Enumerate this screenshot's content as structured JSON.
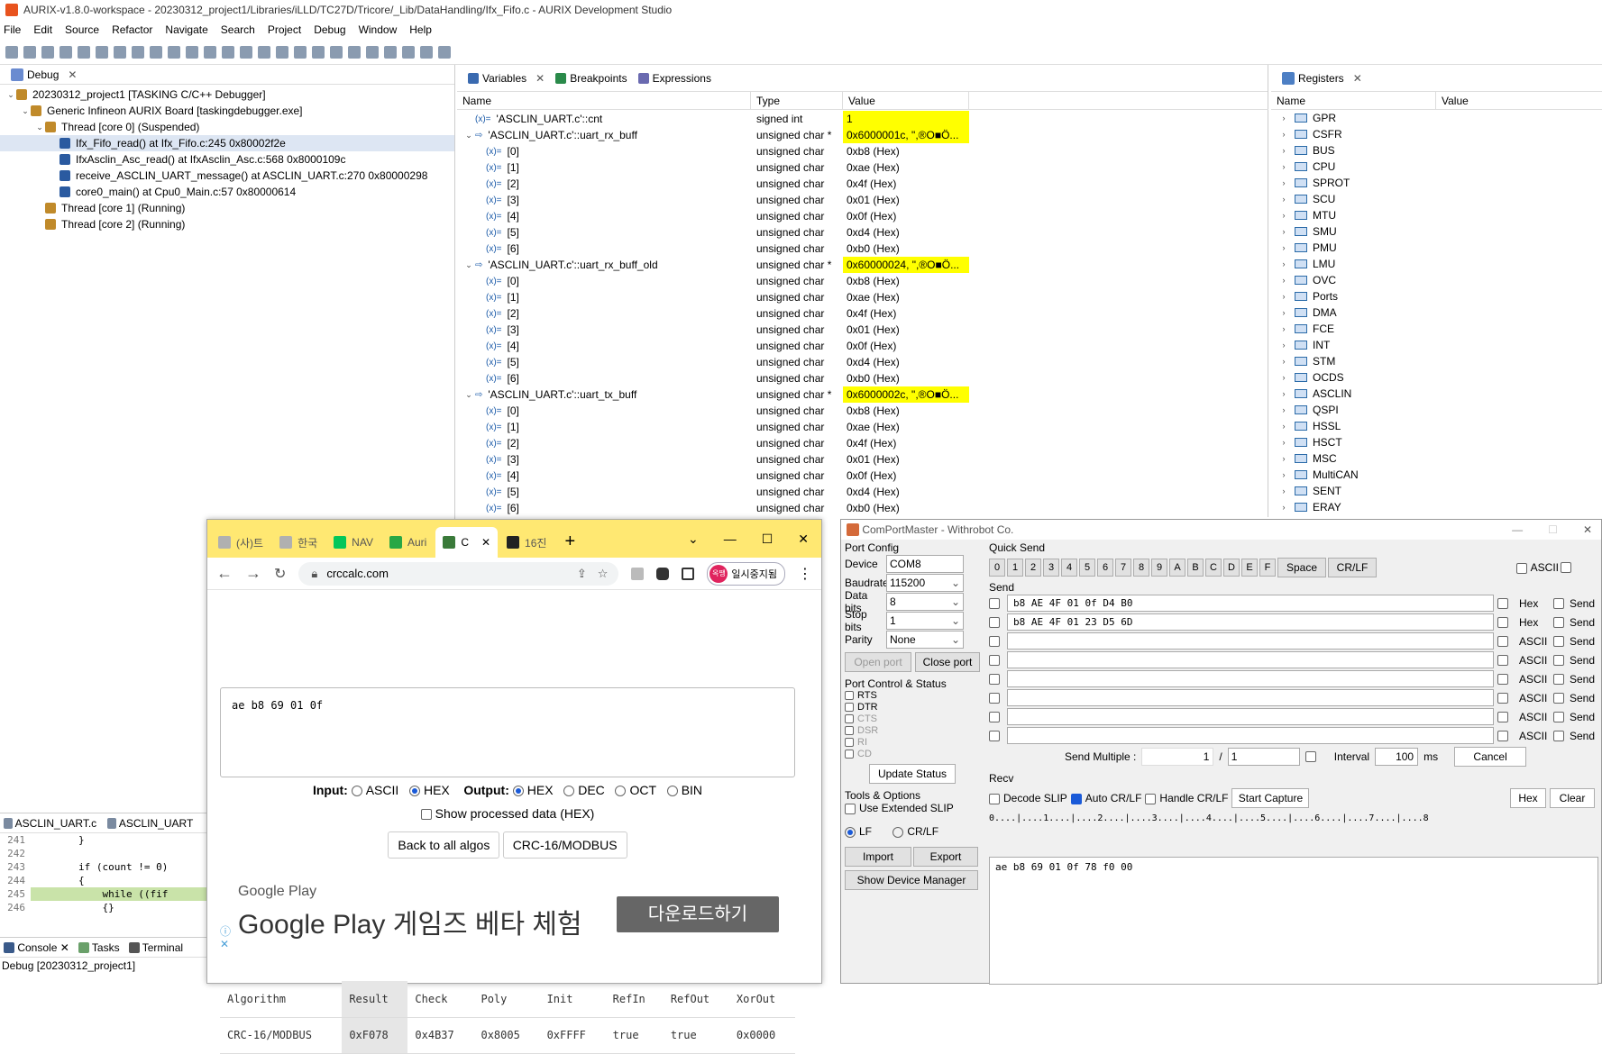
{
  "app": {
    "title": "AURIX-v1.8.0-workspace - 20230312_project1/Libraries/iLLD/TC27D/Tricore/_Lib/DataHandling/Ifx_Fifo.c - AURIX Development Studio",
    "menu": [
      "File",
      "Edit",
      "Source",
      "Refactor",
      "Navigate",
      "Search",
      "Project",
      "Debug",
      "Window",
      "Help"
    ]
  },
  "debug": {
    "tab": "Debug",
    "tree": [
      {
        "text": "20230312_project1 [TASKING C/C++ Debugger]",
        "level": 0,
        "twisty": "v"
      },
      {
        "text": "Generic Infineon AURIX Board [taskingdebugger.exe]",
        "level": 1,
        "twisty": "v"
      },
      {
        "text": "Thread [core 0] (Suspended)",
        "level": 2,
        "twisty": "v"
      },
      {
        "text": "Ifx_Fifo_read() at Ifx_Fifo.c:245 0x80002f2e",
        "level": 3,
        "twisty": "",
        "selected": true
      },
      {
        "text": "IfxAsclin_Asc_read() at IfxAsclin_Asc.c:568 0x8000109c",
        "level": 3,
        "twisty": ""
      },
      {
        "text": "receive_ASCLIN_UART_message() at ASCLIN_UART.c:270 0x80000298",
        "level": 3,
        "twisty": ""
      },
      {
        "text": "core0_main() at Cpu0_Main.c:57 0x80000614",
        "level": 3,
        "twisty": ""
      },
      {
        "text": "Thread [core 1] (Running)",
        "level": 2,
        "twisty": ""
      },
      {
        "text": "Thread [core 2] (Running)",
        "level": 2,
        "twisty": ""
      }
    ]
  },
  "variables": {
    "tabs": [
      "Variables",
      "Breakpoints",
      "Expressions"
    ],
    "columns": [
      "Name",
      "Type",
      "Value"
    ],
    "rows": [
      {
        "name": "'ASCLIN_UART.c'::cnt",
        "type": "signed int",
        "value": "1",
        "hl": true,
        "indent": 0,
        "tw": ""
      },
      {
        "name": "'ASCLIN_UART.c'::uart_rx_buff",
        "type": "unsigned char *",
        "value": "0x6000001c, \",®O■Ö...",
        "hl": true,
        "indent": 0,
        "tw": "v"
      },
      {
        "name": "[0]",
        "type": "unsigned char",
        "value": "0xb8 (Hex)",
        "indent": 1
      },
      {
        "name": "[1]",
        "type": "unsigned char",
        "value": "0xae (Hex)",
        "indent": 1
      },
      {
        "name": "[2]",
        "type": "unsigned char",
        "value": "0x4f (Hex)",
        "indent": 1
      },
      {
        "name": "[3]",
        "type": "unsigned char",
        "value": "0x01 (Hex)",
        "indent": 1
      },
      {
        "name": "[4]",
        "type": "unsigned char",
        "value": "0x0f (Hex)",
        "indent": 1
      },
      {
        "name": "[5]",
        "type": "unsigned char",
        "value": "0xd4 (Hex)",
        "indent": 1
      },
      {
        "name": "[6]",
        "type": "unsigned char",
        "value": "0xb0 (Hex)",
        "indent": 1
      },
      {
        "name": "'ASCLIN_UART.c'::uart_rx_buff_old",
        "type": "unsigned char *",
        "value": "0x60000024, \",®O■Ö...",
        "hl": true,
        "indent": 0,
        "tw": "v"
      },
      {
        "name": "[0]",
        "type": "unsigned char",
        "value": "0xb8 (Hex)",
        "indent": 1
      },
      {
        "name": "[1]",
        "type": "unsigned char",
        "value": "0xae (Hex)",
        "indent": 1
      },
      {
        "name": "[2]",
        "type": "unsigned char",
        "value": "0x4f (Hex)",
        "indent": 1
      },
      {
        "name": "[3]",
        "type": "unsigned char",
        "value": "0x01 (Hex)",
        "indent": 1
      },
      {
        "name": "[4]",
        "type": "unsigned char",
        "value": "0x0f (Hex)",
        "indent": 1
      },
      {
        "name": "[5]",
        "type": "unsigned char",
        "value": "0xd4 (Hex)",
        "indent": 1
      },
      {
        "name": "[6]",
        "type": "unsigned char",
        "value": "0xb0 (Hex)",
        "indent": 1
      },
      {
        "name": "'ASCLIN_UART.c'::uart_tx_buff",
        "type": "unsigned char *",
        "value": "0x6000002c, \",®O■Ö...",
        "hl": true,
        "indent": 0,
        "tw": "v"
      },
      {
        "name": "[0]",
        "type": "unsigned char",
        "value": "0xb8 (Hex)",
        "indent": 1
      },
      {
        "name": "[1]",
        "type": "unsigned char",
        "value": "0xae (Hex)",
        "indent": 1
      },
      {
        "name": "[2]",
        "type": "unsigned char",
        "value": "0x4f (Hex)",
        "indent": 1
      },
      {
        "name": "[3]",
        "type": "unsigned char",
        "value": "0x01 (Hex)",
        "indent": 1
      },
      {
        "name": "[4]",
        "type": "unsigned char",
        "value": "0x0f (Hex)",
        "indent": 1
      },
      {
        "name": "[5]",
        "type": "unsigned char",
        "value": "0xd4 (Hex)",
        "indent": 1
      },
      {
        "name": "[6]",
        "type": "unsigned char",
        "value": "0xb0 (Hex)",
        "indent": 1
      }
    ]
  },
  "registers": {
    "tab": "Registers",
    "columns": [
      "Name",
      "Value"
    ],
    "items": [
      "GPR",
      "CSFR",
      "BUS",
      "CPU",
      "SPROT",
      "SCU",
      "MTU",
      "SMU",
      "PMU",
      "LMU",
      "OVC",
      "Ports",
      "DMA",
      "FCE",
      "INT",
      "STM",
      "OCDS",
      "ASCLIN",
      "QSPI",
      "HSSL",
      "HSCT",
      "MSC",
      "MultiCAN",
      "SENT",
      "ERAY"
    ]
  },
  "editor": {
    "tabs": [
      "ASCLIN_UART.c",
      "ASCLIN_UART"
    ],
    "lines": [
      {
        "num": "241",
        "code": "        }"
      },
      {
        "num": "242",
        "code": ""
      },
      {
        "num": "243",
        "code": "        if (count != 0)"
      },
      {
        "num": "244",
        "code": "        {"
      },
      {
        "num": "245",
        "code": "            while ((fif",
        "current": true
      },
      {
        "num": "246",
        "code": "            {}"
      }
    ]
  },
  "console": {
    "tabs": [
      "Console",
      "Tasks",
      "Terminal"
    ],
    "line": "Debug [20230312_project1]"
  },
  "browser": {
    "tabs": [
      "(사)트",
      "한국",
      "NAV",
      "Auri",
      "C",
      "16진"
    ],
    "url": "crccalc.com",
    "badge": "일시중지됨",
    "badge_avatar": "옥땡",
    "input_text": "ae b8 69 01 0f",
    "input_label": "Input:",
    "input_options": [
      "ASCII",
      "HEX"
    ],
    "output_label": "Output:",
    "output_options": [
      "HEX",
      "DEC",
      "OCT",
      "BIN"
    ],
    "show_processed": "Show processed data (HEX)",
    "back_button": "Back to all algos",
    "algo_button": "CRC-16/MODBUS",
    "ad_brand": "Google Play",
    "ad_text": "Google Play 게임즈 베타 체험",
    "ad_button": "다운로드하기",
    "table_headers": [
      "Algorithm",
      "Result",
      "Check",
      "Poly",
      "Init",
      "RefIn",
      "RefOut",
      "XorOut"
    ],
    "table_row": [
      "CRC-16/MODBUS",
      "0xF078",
      "0x4B37",
      "0x8005",
      "0xFFFF",
      "true",
      "true",
      "0x0000"
    ]
  },
  "comport": {
    "title": "ComPortMaster - Withrobot Co.",
    "port_config": "Port Config",
    "device_label": "Device",
    "device": "COM8",
    "baud_label": "Baudrate",
    "baud": "115200",
    "databits_label": "Data bits",
    "databits": "8",
    "stopbits_label": "Stop bits",
    "stopbits": "1",
    "parity_label": "Parity",
    "parity": "None",
    "open_port": "Open port",
    "close_port": "Close port",
    "port_control": "Port Control & Status",
    "signals": [
      "RTS",
      "DTR",
      "CTS",
      "DSR",
      "RI",
      "CD"
    ],
    "update_status": "Update Status",
    "tools": "Tools & Options",
    "extended_slip": "Use Extended SLIP",
    "lf": "LF",
    "crlf": "CR/LF",
    "import": "Import",
    "export": "Export",
    "device_manager": "Show Device Manager",
    "quick_send": "Quick Send",
    "quick_keys": [
      "0",
      "1",
      "2",
      "3",
      "4",
      "5",
      "6",
      "7",
      "8",
      "9",
      "A",
      "B",
      "C",
      "D",
      "E",
      "F"
    ],
    "space": "Space",
    "crlf_btn": "CR/LF",
    "ascii": "ASCII",
    "send_label": "Send",
    "send_rows": [
      {
        "text": "b8 AE 4F 01 0f D4 B0",
        "mode": "Hex"
      },
      {
        "text": "b8 AE 4F 01 23 D5 6D",
        "mode": "Hex"
      },
      {
        "text": "",
        "mode": "ASCII"
      },
      {
        "text": "",
        "mode": "ASCII"
      },
      {
        "text": "",
        "mode": "ASCII"
      },
      {
        "text": "",
        "mode": "ASCII"
      },
      {
        "text": "",
        "mode": "ASCII"
      },
      {
        "text": "",
        "mode": "ASCII"
      }
    ],
    "send_btn": "Send",
    "send_multiple": "Send Multiple :",
    "sm_a": "1",
    "sm_sep": "/",
    "sm_b": "1",
    "interval": "Interval",
    "interval_val": "100",
    "ms": "ms",
    "cancel": "Cancel",
    "recv_label": "Recv",
    "decode_slip": "Decode SLIP",
    "auto_crlf": "Auto CR/LF",
    "handle_crlf": "Handle CR/LF",
    "start_capture": "Start Capture",
    "hex": "Hex",
    "clear": "Clear",
    "ruler": "0....|....1....|....2....|....3....|....4....|....5....|....6....|....7....|....8",
    "recv_text": "ae b8 69 01 0f 78 f0 00"
  }
}
